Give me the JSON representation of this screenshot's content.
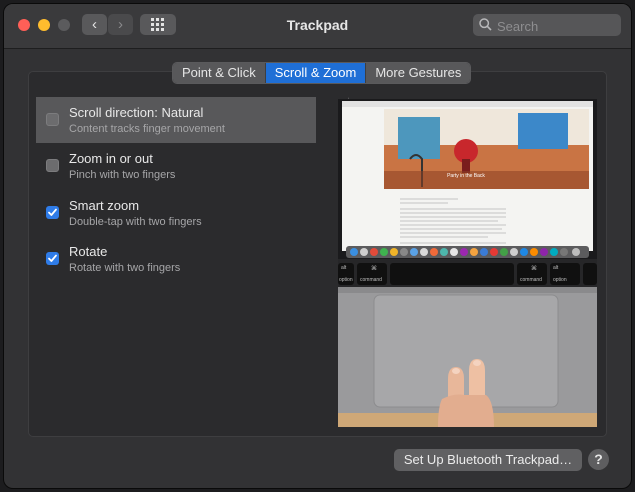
{
  "window": {
    "title": "Trackpad"
  },
  "toolbar": {
    "search_placeholder": "Search"
  },
  "tabs": [
    {
      "label": "Point & Click",
      "active": false
    },
    {
      "label": "Scroll & Zoom",
      "active": true
    },
    {
      "label": "More Gestures",
      "active": false
    }
  ],
  "options": [
    {
      "title": "Scroll direction: Natural",
      "subtitle": "Content tracks finger movement",
      "checked": false,
      "selected": true
    },
    {
      "title": "Zoom in or out",
      "subtitle": "Pinch with two fingers",
      "checked": false,
      "selected": false
    },
    {
      "title": "Smart zoom",
      "subtitle": "Double-tap with two fingers",
      "checked": true,
      "selected": false
    },
    {
      "title": "Rotate",
      "subtitle": "Rotate with two fingers",
      "checked": true,
      "selected": false
    }
  ],
  "preview": {
    "article_heading": "Party in the Back",
    "keys": {
      "alt_left": "alt",
      "option_left": "option",
      "cmd_left": "command",
      "cmd_right": "command",
      "alt_right": "alt",
      "option_right": "option"
    }
  },
  "footer": {
    "setup_button": "Set Up Bluetooth Trackpad…",
    "help": "?"
  },
  "colors": {
    "accent": "#1f6fd6",
    "checkbox_on": "#2f7ce8",
    "window_bg": "#323234"
  }
}
